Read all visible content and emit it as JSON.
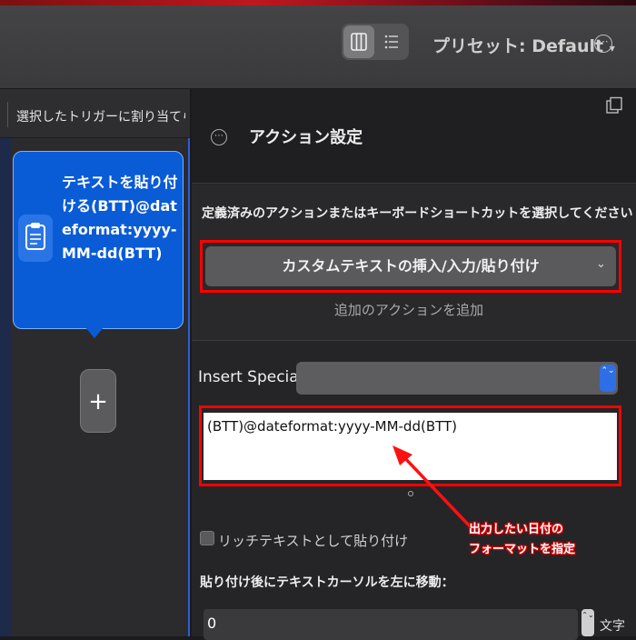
{
  "toolbar": {
    "preset_label": "プリセット: Default",
    "preset_chevron": "▾",
    "view_toggle_icons": [
      "column-view-icon",
      "list-view-icon"
    ],
    "more_icon": "ellipsis-circle-icon",
    "more_glyph": "⋯"
  },
  "left_panel": {
    "header": "選択したトリガーに割り当てられ…",
    "card": {
      "icon": "clipboard-icon",
      "text": "テキストを貼り付ける(BTT)@dateformat:yyyy-MM-dd(BTT)"
    },
    "add_button": "+"
  },
  "right_panel": {
    "settings_icon_glyph": "⋯",
    "title": "アクション設定",
    "instruction": "定義済みのアクションまたはキーボードショートカットを選択してください",
    "action_select": {
      "value": "カスタムテキストの挿入/入力/貼り付け",
      "chevron": "⌄"
    },
    "add_action": "追加のアクションを追加",
    "insert_special": {
      "label": "Insert Special:",
      "stepper": "⌃⌄"
    },
    "text_content": "(BTT)@dateformat:yyyy-MM-dd(BTT)",
    "annotation": {
      "line1": "出力したい日付の",
      "line2": "フォーマットを指定"
    },
    "rich_text_label": "リッチテキストとして貼り付け",
    "cursor_move_label": "貼り付け後にテキストカーソルを左に移動：",
    "cursor_move_value": "0",
    "cursor_stepper": "⌃⌄",
    "cursor_unit": "文字"
  },
  "colors": {
    "accent_blue": "#0a5bd6",
    "highlight_red": "#ff0000"
  }
}
